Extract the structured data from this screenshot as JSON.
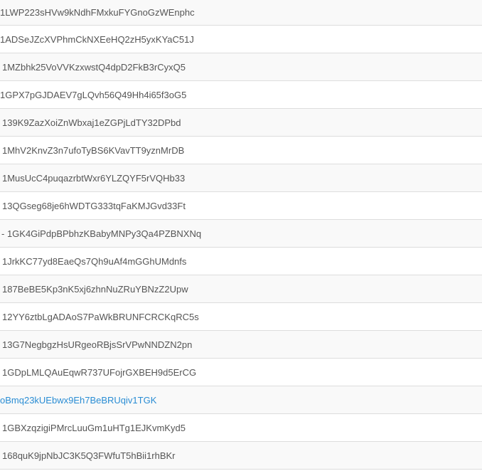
{
  "addresses": [
    {
      "text": "1LWP223sHVw9kNdhFMxkuFYGnoGzWEnphc",
      "link": false
    },
    {
      "text": "1ADSeJZcXVPhmCkNXEeHQ2zH5yxKYaC51J",
      "link": false
    },
    {
      "text": "1MZbhk25VoVVKzxwstQ4dpD2FkB3rCyxQ5",
      "link": false
    },
    {
      "text": "1GPX7pGJDAEV7gLQvh56Q49Hh4i65f3oG5",
      "link": false
    },
    {
      "text": "139K9ZazXoiZnWbxaj1eZGPjLdTY32DPbd",
      "link": false
    },
    {
      "text": "1MhV2KnvZ3n7ufoTyBS6KVavTT9yznMrDB",
      "link": false
    },
    {
      "text": "1MusUcC4puqazrbtWxr6YLZQYF5rVQHb33",
      "link": false
    },
    {
      "text": "13QGseg68je6hWDTG333tqFaKMJGvd33Ft",
      "link": false
    },
    {
      "text": "- 1GK4GiPdpBPbhzKBabyMNPy3Qa4PZBNXNq",
      "link": false
    },
    {
      "text": "1JrkKC77yd8EaeQs7Qh9uAf4mGGhUMdnfs",
      "link": false
    },
    {
      "text": "187BeBE5Kp3nK5xj6zhnNuZRuYBNzZ2Upw",
      "link": false
    },
    {
      "text": "12YY6ztbLgADAoS7PaWkBRUNFCRCKqRC5s",
      "link": false
    },
    {
      "text": "13G7NegbgzHsURgeoRBjsSrVPwNNDZN2pn",
      "link": false
    },
    {
      "text": "1GDpLMLQAuEqwR737UFojrGXBEH9d5ErCG",
      "link": false
    },
    {
      "text": "oBmq23kUEbwx9Eh7BeBRUqiv1TGK",
      "link": true
    },
    {
      "text": "1GBXzqzigiPMrcLuuGm1uHTg1EJKvmKyd5",
      "link": false
    },
    {
      "text": "168quK9jpNbJC3K5Q3FWfuT5hBii1rhBKr",
      "link": false
    }
  ],
  "colors": {
    "text": "#555555",
    "link": "#2a8dd4",
    "stripe": "#f9f9f9",
    "border": "#dddddd"
  }
}
